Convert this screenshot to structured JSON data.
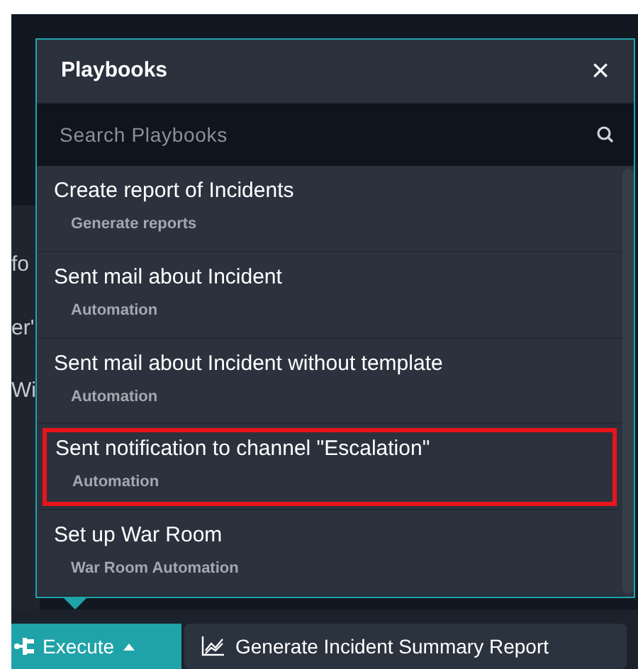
{
  "background_fragments": [
    {
      "text": "fo"
    },
    {
      "text": "er'"
    },
    {
      "text": "Wi"
    }
  ],
  "popup": {
    "title": "Playbooks",
    "close": "×",
    "search": {
      "placeholder": "Search Playbooks"
    },
    "items": [
      {
        "title": "Create report of Incidents",
        "subtitle": "Generate reports",
        "highlighted": false
      },
      {
        "title": "Sent mail about Incident",
        "subtitle": "Automation",
        "highlighted": false
      },
      {
        "title": "Sent mail about Incident without template",
        "subtitle": "Automation",
        "highlighted": false
      },
      {
        "title": "Sent notification to channel \"Escalation\"",
        "subtitle": "Automation",
        "highlighted": true
      },
      {
        "title": "Set up War Room",
        "subtitle": "War Room Automation",
        "highlighted": false
      }
    ]
  },
  "toolbar": {
    "execute": {
      "label": "Execute",
      "expanded": true
    },
    "report_button": "Generate Incident Summary Report"
  }
}
